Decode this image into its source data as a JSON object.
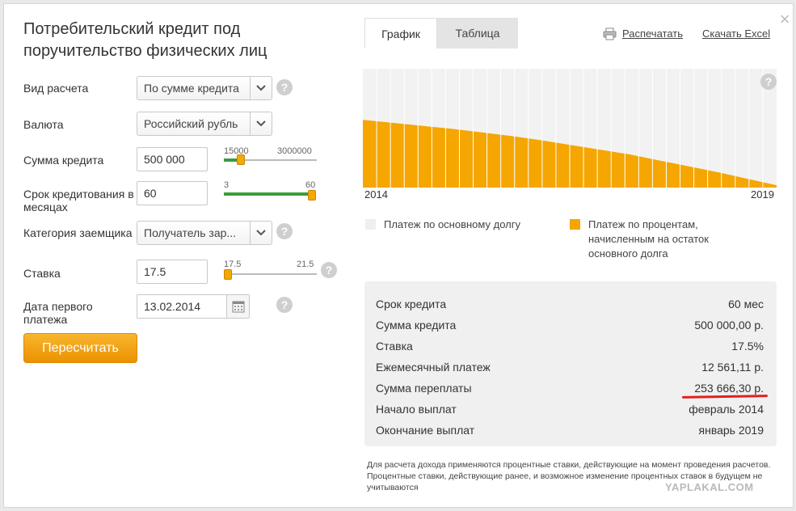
{
  "title": "Потребительский кредит под поручительство физических лиц",
  "close_icon": "close-icon",
  "form": {
    "calc_type": {
      "label": "Вид расчета",
      "value": "По сумме кредита"
    },
    "currency": {
      "label": "Валюта",
      "value": "Российский рубль"
    },
    "amount": {
      "label": "Сумма кредита",
      "value": "500 000",
      "min": "15000",
      "max": "3000000",
      "level": 0.16
    },
    "term": {
      "label": "Срок кредитования в месяцах",
      "value": "60",
      "min": "3",
      "max": "60",
      "level": 1.0
    },
    "category": {
      "label": "Категория заемщика",
      "value": "Получатель зар..."
    },
    "rate": {
      "label": "Ставка",
      "value": "17.5",
      "min": "17.5",
      "max": "21.5",
      "level": 0.0
    },
    "first_payment": {
      "label": "Дата первого платежа",
      "value": "13.02.2014"
    },
    "recalc_label": "Пересчитать"
  },
  "tabs": {
    "graph": "График",
    "table": "Таблица"
  },
  "links": {
    "print": "Распечатать",
    "excel": "Скачать Excel"
  },
  "chart_data": {
    "type": "area",
    "x_start_label": "2014",
    "x_end_label": "2019",
    "periods": 60,
    "ylim": [
      0,
      1
    ],
    "series": [
      {
        "name": "Платеж по основному долгу",
        "color": "#f2f2f2"
      },
      {
        "name": "Платеж по процентам, начисленным на остаток основного долга",
        "color": "#f5a600",
        "values": [
          0.57,
          0.545,
          0.52,
          0.495,
          0.465,
          0.435,
          0.4,
          0.36,
          0.32,
          0.28,
          0.23,
          0.18,
          0.13,
          0.075,
          0.02
        ]
      }
    ]
  },
  "summary": [
    {
      "label": "Срок кредита",
      "value": "60 мес"
    },
    {
      "label": "Сумма кредита",
      "value": "500 000,00 р."
    },
    {
      "label": "Ставка",
      "value": "17.5%"
    },
    {
      "label": "Ежемесячный платеж",
      "value": "12 561,11 р."
    },
    {
      "label": "Сумма переплаты",
      "value": "253 666,30 р."
    },
    {
      "label": "Начало выплат",
      "value": "февраль 2014"
    },
    {
      "label": "Окончание выплат",
      "value": "январь 2019"
    }
  ],
  "footnote": "Для расчета дохода применяются процентные ставки, действующие на момент проведения расчетов. Процентные ставки, действующие ранее, и возможное изменение процентных ставок в будущем не учитываются",
  "watermark": "YAPLAKAL.COM",
  "accent": "#f5a600",
  "green": "#3a9d3a",
  "highlight_red": "#e02020"
}
